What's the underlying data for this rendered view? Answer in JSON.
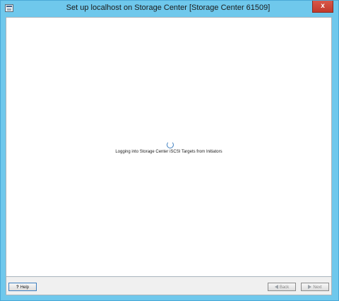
{
  "window": {
    "title": "Set up localhost on Storage Center [Storage Center 61509]",
    "close_glyph": "x"
  },
  "main": {
    "status_text": "Logging into Storage Center iSCSI Targets from Initiators"
  },
  "footer": {
    "help_icon": "?",
    "help_label": "Help",
    "back_label": "Back",
    "next_label": "Next"
  },
  "icons": {
    "app": "app-icon",
    "spinner": "loading-spinner-icon",
    "back": "arrow-left-icon",
    "next": "arrow-right-icon"
  },
  "colors": {
    "frame": "#6fc8ec",
    "close": "#c23a2b",
    "spinner": "#3d7ebf"
  }
}
